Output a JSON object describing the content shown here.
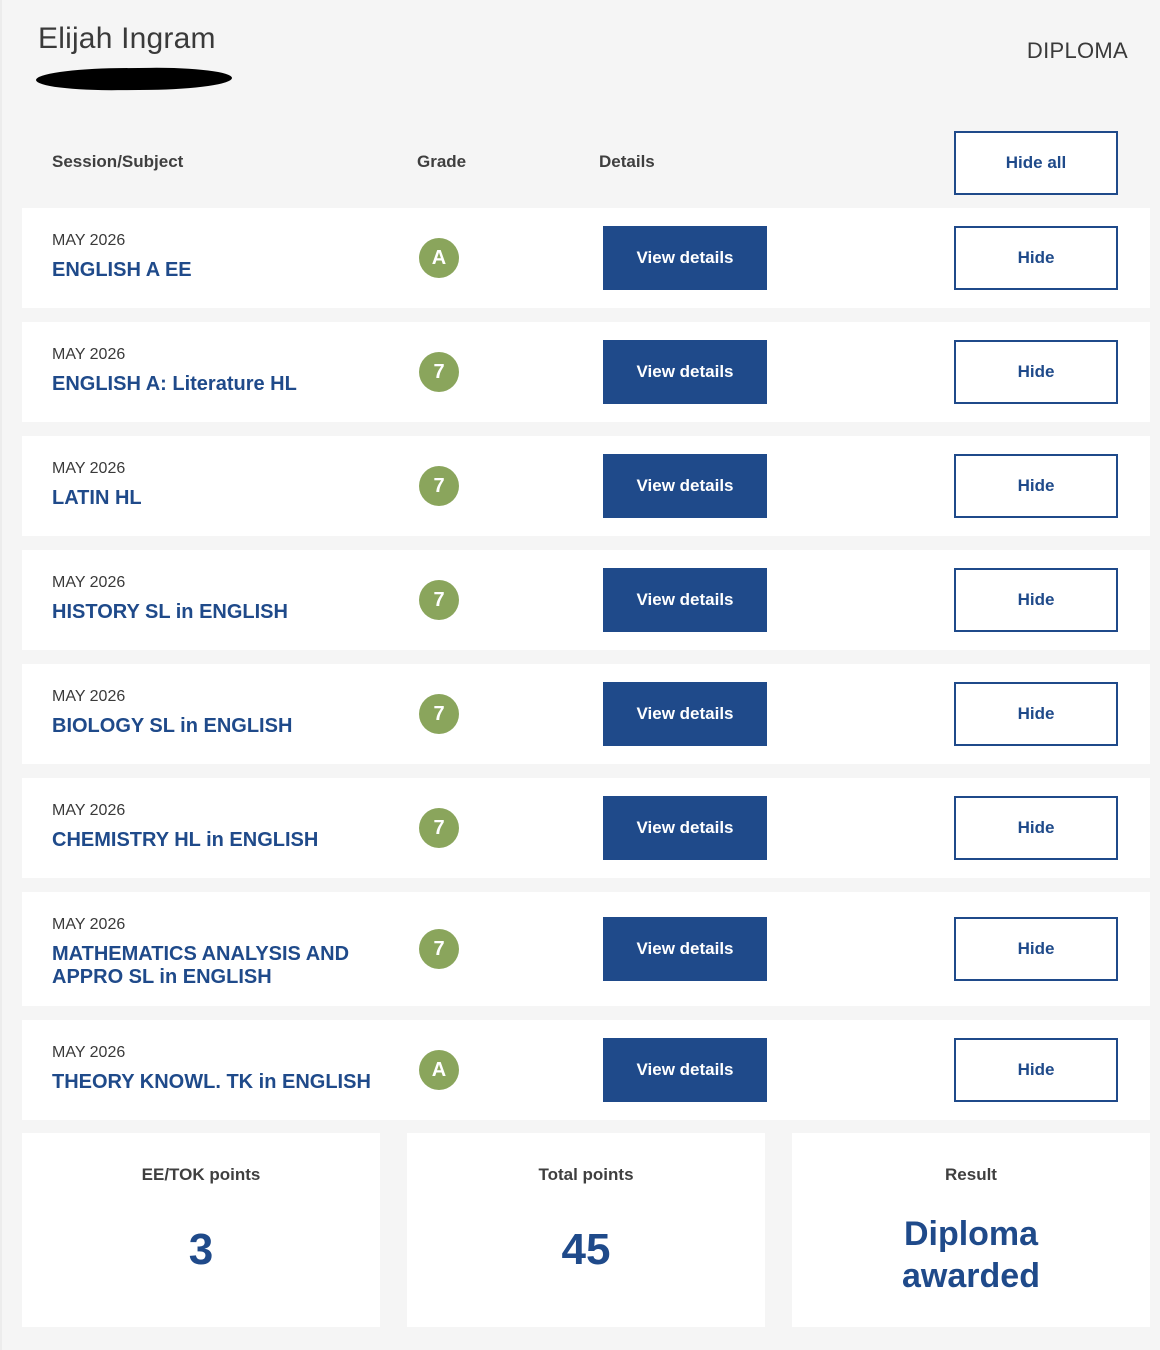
{
  "candidate": {
    "name": "Elijah Ingram"
  },
  "program": "DIPLOMA",
  "columns": {
    "subject": "Session/Subject",
    "grade": "Grade",
    "details": "Details",
    "hide_all": "Hide all"
  },
  "labels": {
    "view_details": "View details",
    "hide": "Hide"
  },
  "rows": [
    {
      "session": "MAY 2026",
      "subject": "ENGLISH A EE",
      "grade": "A"
    },
    {
      "session": "MAY 2026",
      "subject": "ENGLISH A: Literature HL",
      "grade": "7"
    },
    {
      "session": "MAY 2026",
      "subject": "LATIN HL",
      "grade": "7"
    },
    {
      "session": "MAY 2026",
      "subject": "HISTORY SL in ENGLISH",
      "grade": "7"
    },
    {
      "session": "MAY 2026",
      "subject": "BIOLOGY SL in ENGLISH",
      "grade": "7"
    },
    {
      "session": "MAY 2026",
      "subject": "CHEMISTRY HL in ENGLISH",
      "grade": "7"
    },
    {
      "session": "MAY 2026",
      "subject": "MATHEMATICS ANALYSIS AND APPRO SL in ENGLISH",
      "grade": "7"
    },
    {
      "session": "MAY 2026",
      "subject": "THEORY KNOWL. TK in ENGLISH",
      "grade": "A"
    }
  ],
  "summary": {
    "ee_tok_label": "EE/TOK points",
    "ee_tok_value": "3",
    "total_label": "Total points",
    "total_value": "45",
    "result_label": "Result",
    "result_value": "Diploma awarded"
  },
  "colors": {
    "primary": "#1f4a8a",
    "grade_badge": "#8aa55c",
    "page_background": "#f5f5f5"
  }
}
